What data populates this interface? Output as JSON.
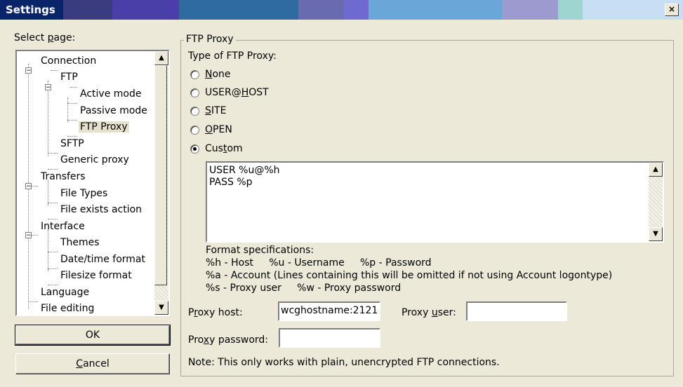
{
  "window": {
    "title": "Settings",
    "close_glyph": "×"
  },
  "select_page_label": "Select page:",
  "tree": [
    {
      "label": "Connection"
    },
    {
      "label": "FTP"
    },
    {
      "label": "Active mode"
    },
    {
      "label": "Passive mode"
    },
    {
      "label": "FTP Proxy"
    },
    {
      "label": "SFTP"
    },
    {
      "label": "Generic proxy"
    },
    {
      "label": "Transfers"
    },
    {
      "label": "File Types"
    },
    {
      "label": "File exists action"
    },
    {
      "label": "Interface"
    },
    {
      "label": "Themes"
    },
    {
      "label": "Date/time format"
    },
    {
      "label": "Filesize format"
    },
    {
      "label": "Language"
    },
    {
      "label": "File editing"
    }
  ],
  "buttons": {
    "ok": "OK",
    "cancel": "Cancel"
  },
  "ftp_proxy": {
    "group_title": "FTP Proxy",
    "type_label": "Type of FTP Proxy:",
    "options": [
      "None",
      "USER@HOST",
      "SITE",
      "OPEN",
      "Custom"
    ],
    "selected_option": "Custom",
    "custom_script": "USER %u@%h\nPASS %p",
    "format_title": "Format specifications:",
    "format_line1": "%h - Host     %u - Username     %p - Password",
    "format_line2": "%a - Account (Lines containing this will be omitted if not using Account logontype)",
    "format_line3": "%s - Proxy user     %w - Proxy password",
    "proxy_host_label": "Proxy host:",
    "proxy_host_value": "wcghostname:2121",
    "proxy_user_label": "Proxy user:",
    "proxy_user_value": "",
    "proxy_password_label": "Proxy password:",
    "proxy_password_value": "",
    "note": "Note: This only works with plain, unencrypted FTP connections."
  }
}
